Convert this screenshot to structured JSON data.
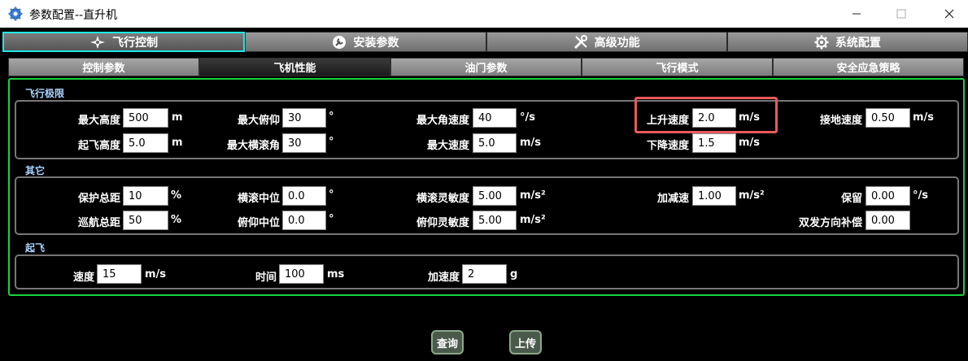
{
  "window": {
    "title": "参数配置--直升机"
  },
  "main_tabs": [
    {
      "label": "飞行控制",
      "icon": "plane-icon",
      "active": true
    },
    {
      "label": "安装参数",
      "icon": "wrench-circle-icon",
      "active": false
    },
    {
      "label": "高级功能",
      "icon": "tools-icon",
      "active": false
    },
    {
      "label": "系统配置",
      "icon": "gear-icon",
      "active": false
    }
  ],
  "sub_tabs": [
    {
      "label": "控制参数",
      "active": false
    },
    {
      "label": "飞机性能",
      "active": true
    },
    {
      "label": "油门参数",
      "active": false
    },
    {
      "label": "飞行模式",
      "active": false
    },
    {
      "label": "安全应急策略",
      "active": false
    }
  ],
  "flight_limits": {
    "title": "飞行极限",
    "max_altitude": {
      "label": "最大高度",
      "value": "500",
      "unit": "m"
    },
    "takeoff_altitude": {
      "label": "起飞高度",
      "value": "5.0",
      "unit": "m"
    },
    "max_pitch": {
      "label": "最大俯仰",
      "value": "30",
      "unit": "°"
    },
    "max_roll": {
      "label": "最大横滚角",
      "value": "30",
      "unit": "°"
    },
    "max_angular_speed": {
      "label": "最大角速度",
      "value": "40",
      "unit": "°/s"
    },
    "max_speed": {
      "label": "最大速度",
      "value": "5.0",
      "unit": "m/s"
    },
    "climb_speed": {
      "label": "上升速度",
      "value": "2.0",
      "unit": "m/s"
    },
    "descent_speed": {
      "label": "下降速度",
      "value": "1.5",
      "unit": "m/s"
    },
    "landing_speed": {
      "label": "接地速度",
      "value": "0.50",
      "unit": "m/s"
    }
  },
  "other": {
    "title": "其它",
    "protect_collective": {
      "label": "保护总距",
      "value": "10",
      "unit": "%"
    },
    "cruise_collective": {
      "label": "巡航总距",
      "value": "50",
      "unit": "%"
    },
    "roll_center": {
      "label": "横滚中位",
      "value": "0.0",
      "unit": "°"
    },
    "pitch_center": {
      "label": "俯仰中位",
      "value": "0.0",
      "unit": "°"
    },
    "roll_sensitivity": {
      "label": "横滚灵敏度",
      "value": "5.00",
      "unit": "m/s²"
    },
    "pitch_sensitivity": {
      "label": "俯仰灵敏度",
      "value": "5.00",
      "unit": "m/s²"
    },
    "accel_decel": {
      "label": "加减速",
      "value": "1.00",
      "unit": "m/s²"
    },
    "reserved": {
      "label": "保留",
      "value": "0.00",
      "unit": "°/s"
    },
    "twin_engine_comp": {
      "label": "双发方向补偿",
      "value": "0.00"
    }
  },
  "takeoff": {
    "title": "起飞",
    "speed": {
      "label": "速度",
      "value": "15",
      "unit": "m/s"
    },
    "time": {
      "label": "时间",
      "value": "100",
      "unit": "ms"
    },
    "acceleration": {
      "label": "加速度",
      "value": "2",
      "unit": "g"
    }
  },
  "actions": {
    "query": "查询",
    "upload": "上传"
  },
  "colors": {
    "active_tab_border": "#1ee8e8",
    "panel_border": "#18d33c",
    "section_title": "#a9d3ff",
    "highlight": "#e85a5a"
  }
}
